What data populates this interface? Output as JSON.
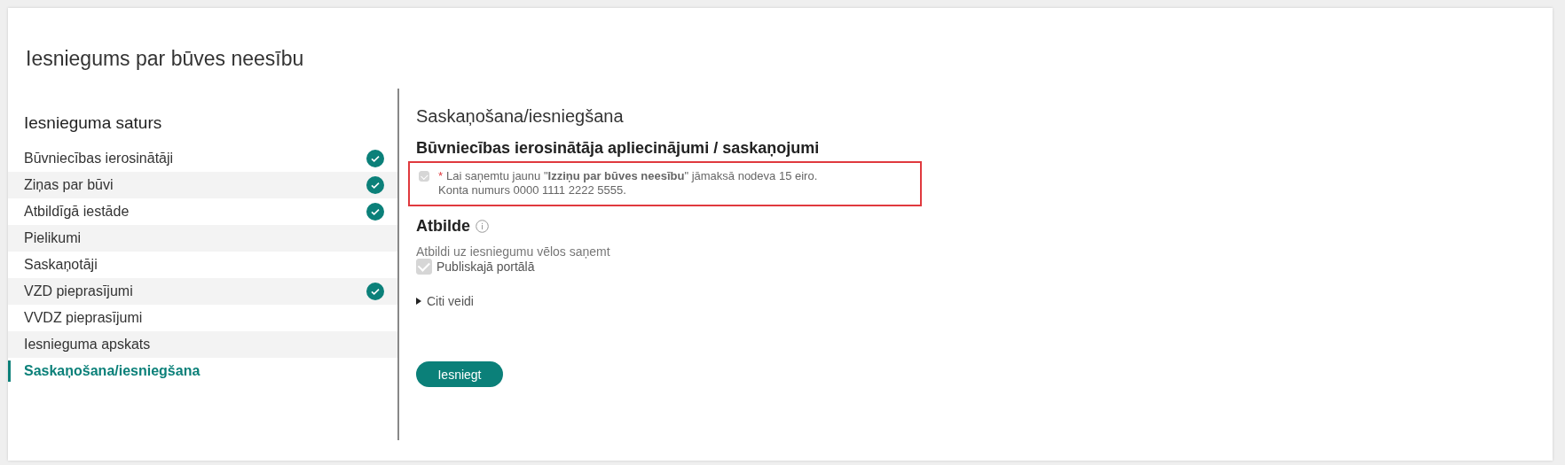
{
  "page": {
    "title": "Iesniegums par būves neesību"
  },
  "sidebar": {
    "title": "Iesnieguma saturs",
    "items": [
      {
        "label": "Būvniecības ierosinātāji",
        "done": true,
        "selected": false
      },
      {
        "label": "Ziņas par būvi",
        "done": true,
        "selected": false
      },
      {
        "label": "Atbildīgā iestāde",
        "done": true,
        "selected": false
      },
      {
        "label": "Pielikumi",
        "done": false,
        "selected": false
      },
      {
        "label": "Saskaņotāji",
        "done": false,
        "selected": false
      },
      {
        "label": "VZD pieprasījumi",
        "done": true,
        "selected": false
      },
      {
        "label": "VVDZ pieprasījumi",
        "done": false,
        "selected": false
      },
      {
        "label": "Iesnieguma apskats",
        "done": false,
        "selected": false
      },
      {
        "label": "Saskaņošana/iesniegšana",
        "done": false,
        "selected": true
      }
    ]
  },
  "main": {
    "title": "Saskaņošana/iesniegšana",
    "confirmations": {
      "title": "Būvniecības ierosinātāja apliecinājumi / saskaņojumi",
      "checked": true,
      "disabled": true,
      "highlighted": true,
      "required_mark": "*",
      "lines": [
        "Lai saņemtu jaunu \"**Izziņu par būves neesību**\" jāmaksā nodeva 15 eiro.",
        "Konta numurs 0000 1111 2222 5555."
      ]
    },
    "answer": {
      "title": "Atbilde",
      "hint": "Atbildi uz iesniegumu vēlos saņemt",
      "options": [
        {
          "label": "Publiskajā portālā",
          "checked": true,
          "disabled": true
        }
      ]
    },
    "more": {
      "label": "Citi veidi",
      "expanded": false
    },
    "submit": "Iesniegt"
  }
}
